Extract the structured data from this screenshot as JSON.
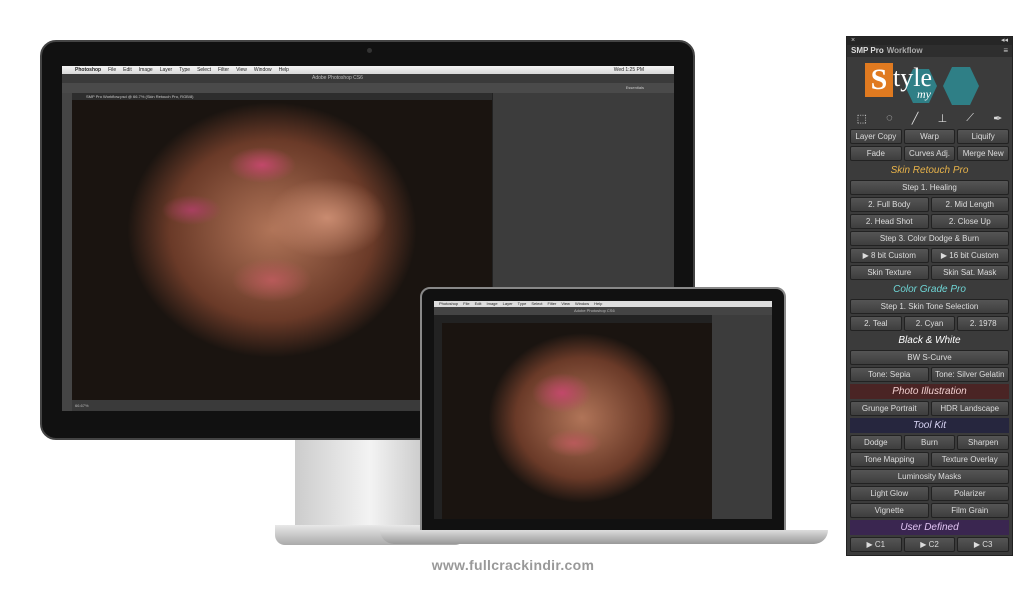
{
  "monitor": {
    "menu": [
      "Photoshop",
      "File",
      "Edit",
      "Image",
      "Layer",
      "Type",
      "Select",
      "Filter",
      "View",
      "Window",
      "Help"
    ],
    "clock": "Wed 1:25 PM",
    "app_title": "Adobe Photoshop CS6",
    "doc_tab": "SMP Pro Workflow.psd @ 66.7% (Skin Retouch Pro, RGB/8)",
    "essentials": "Essentials",
    "status": "66.67%"
  },
  "laptop": {
    "menu": [
      "Photoshop",
      "File",
      "Edit",
      "Image",
      "Layer",
      "Type",
      "Select",
      "Filter",
      "View",
      "Window",
      "Help"
    ],
    "app_title": "Adobe Photoshop CS6"
  },
  "website": "www.fullcrackindir.com",
  "panel": {
    "close": "×",
    "collapse": "◂◂",
    "title": "SMP Pro",
    "title_suffix": "Workflow",
    "menu_icon": "≡",
    "logo_text": "Style my",
    "tool_icons": [
      "marquee-icon",
      "lasso-icon",
      "brush-icon",
      "stamp-icon",
      "eyedropper-icon",
      "pen-icon"
    ],
    "sections": [
      {
        "rows": [
          [
            "Layer Copy",
            "Warp",
            "Liquify"
          ],
          [
            "Fade",
            "Curves Adj.",
            "Merge New"
          ]
        ]
      },
      {
        "header": "Skin Retouch Pro",
        "color": "#e8b34a",
        "bg": "transparent",
        "rows": [
          [
            "Step 1. Healing"
          ],
          [
            "2. Full Body",
            "2. Mid Length"
          ],
          [
            "2. Head Shot",
            "2. Close Up"
          ],
          [
            "Step 3. Color Dodge & Burn"
          ],
          [
            "▶ 8 bit Custom",
            "▶ 16 bit Custom"
          ],
          [
            "Skin Texture",
            "Skin Sat. Mask"
          ]
        ]
      },
      {
        "header": "Color Grade Pro",
        "color": "#6fd6d6",
        "bg": "transparent",
        "rows": [
          [
            "Step 1. Skin Tone Selection"
          ],
          [
            "2. Teal",
            "2. Cyan",
            "2. 1978"
          ]
        ]
      },
      {
        "header": "Black & White",
        "color": "#ffffff",
        "bg": "transparent",
        "rows": [
          [
            "BW S-Curve"
          ],
          [
            "Tone: Sepia",
            "Tone: Silver Gelatin"
          ]
        ]
      },
      {
        "header": "Photo Illustration",
        "color": "#f2d0d0",
        "bg": "#4a2424",
        "rows": [
          [
            "Grunge Portrait",
            "HDR Landscape"
          ]
        ]
      },
      {
        "header": "Tool Kit",
        "color": "#d8d4f4",
        "bg": "#26263e",
        "rows": [
          [
            "Dodge",
            "Burn",
            "Sharpen"
          ],
          [
            "Tone Mapping",
            "Texture Overlay"
          ],
          [
            "Luminosity Masks"
          ],
          [
            "Light Glow",
            "Polarizer"
          ],
          [
            "Vignette",
            "Film Grain"
          ]
        ]
      },
      {
        "header": "User Defined",
        "color": "#e2c4f4",
        "bg": "#3a2650",
        "rows": [
          [
            "▶ C1",
            "▶ C2",
            "▶ C3"
          ]
        ]
      }
    ]
  }
}
